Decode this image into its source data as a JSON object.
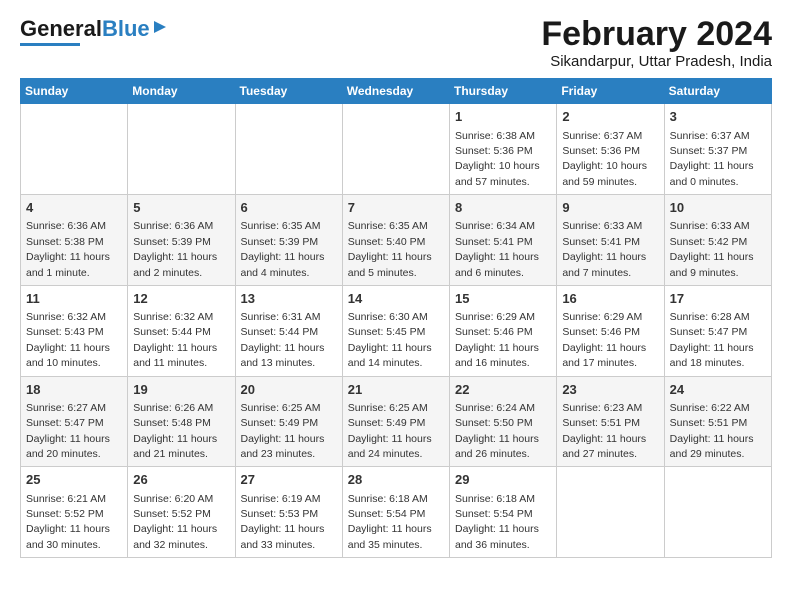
{
  "header": {
    "logo_general": "General",
    "logo_blue": "Blue",
    "title": "February 2024",
    "subtitle": "Sikandarpur, Uttar Pradesh, India"
  },
  "days_of_week": [
    "Sunday",
    "Monday",
    "Tuesday",
    "Wednesday",
    "Thursday",
    "Friday",
    "Saturday"
  ],
  "weeks": [
    [
      {
        "day": "",
        "info": ""
      },
      {
        "day": "",
        "info": ""
      },
      {
        "day": "",
        "info": ""
      },
      {
        "day": "",
        "info": ""
      },
      {
        "day": "1",
        "info": "Sunrise: 6:38 AM\nSunset: 5:36 PM\nDaylight: 10 hours and 57 minutes."
      },
      {
        "day": "2",
        "info": "Sunrise: 6:37 AM\nSunset: 5:36 PM\nDaylight: 10 hours and 59 minutes."
      },
      {
        "day": "3",
        "info": "Sunrise: 6:37 AM\nSunset: 5:37 PM\nDaylight: 11 hours and 0 minutes."
      }
    ],
    [
      {
        "day": "4",
        "info": "Sunrise: 6:36 AM\nSunset: 5:38 PM\nDaylight: 11 hours and 1 minute."
      },
      {
        "day": "5",
        "info": "Sunrise: 6:36 AM\nSunset: 5:39 PM\nDaylight: 11 hours and 2 minutes."
      },
      {
        "day": "6",
        "info": "Sunrise: 6:35 AM\nSunset: 5:39 PM\nDaylight: 11 hours and 4 minutes."
      },
      {
        "day": "7",
        "info": "Sunrise: 6:35 AM\nSunset: 5:40 PM\nDaylight: 11 hours and 5 minutes."
      },
      {
        "day": "8",
        "info": "Sunrise: 6:34 AM\nSunset: 5:41 PM\nDaylight: 11 hours and 6 minutes."
      },
      {
        "day": "9",
        "info": "Sunrise: 6:33 AM\nSunset: 5:41 PM\nDaylight: 11 hours and 7 minutes."
      },
      {
        "day": "10",
        "info": "Sunrise: 6:33 AM\nSunset: 5:42 PM\nDaylight: 11 hours and 9 minutes."
      }
    ],
    [
      {
        "day": "11",
        "info": "Sunrise: 6:32 AM\nSunset: 5:43 PM\nDaylight: 11 hours and 10 minutes."
      },
      {
        "day": "12",
        "info": "Sunrise: 6:32 AM\nSunset: 5:44 PM\nDaylight: 11 hours and 11 minutes."
      },
      {
        "day": "13",
        "info": "Sunrise: 6:31 AM\nSunset: 5:44 PM\nDaylight: 11 hours and 13 minutes."
      },
      {
        "day": "14",
        "info": "Sunrise: 6:30 AM\nSunset: 5:45 PM\nDaylight: 11 hours and 14 minutes."
      },
      {
        "day": "15",
        "info": "Sunrise: 6:29 AM\nSunset: 5:46 PM\nDaylight: 11 hours and 16 minutes."
      },
      {
        "day": "16",
        "info": "Sunrise: 6:29 AM\nSunset: 5:46 PM\nDaylight: 11 hours and 17 minutes."
      },
      {
        "day": "17",
        "info": "Sunrise: 6:28 AM\nSunset: 5:47 PM\nDaylight: 11 hours and 18 minutes."
      }
    ],
    [
      {
        "day": "18",
        "info": "Sunrise: 6:27 AM\nSunset: 5:47 PM\nDaylight: 11 hours and 20 minutes."
      },
      {
        "day": "19",
        "info": "Sunrise: 6:26 AM\nSunset: 5:48 PM\nDaylight: 11 hours and 21 minutes."
      },
      {
        "day": "20",
        "info": "Sunrise: 6:25 AM\nSunset: 5:49 PM\nDaylight: 11 hours and 23 minutes."
      },
      {
        "day": "21",
        "info": "Sunrise: 6:25 AM\nSunset: 5:49 PM\nDaylight: 11 hours and 24 minutes."
      },
      {
        "day": "22",
        "info": "Sunrise: 6:24 AM\nSunset: 5:50 PM\nDaylight: 11 hours and 26 minutes."
      },
      {
        "day": "23",
        "info": "Sunrise: 6:23 AM\nSunset: 5:51 PM\nDaylight: 11 hours and 27 minutes."
      },
      {
        "day": "24",
        "info": "Sunrise: 6:22 AM\nSunset: 5:51 PM\nDaylight: 11 hours and 29 minutes."
      }
    ],
    [
      {
        "day": "25",
        "info": "Sunrise: 6:21 AM\nSunset: 5:52 PM\nDaylight: 11 hours and 30 minutes."
      },
      {
        "day": "26",
        "info": "Sunrise: 6:20 AM\nSunset: 5:52 PM\nDaylight: 11 hours and 32 minutes."
      },
      {
        "day": "27",
        "info": "Sunrise: 6:19 AM\nSunset: 5:53 PM\nDaylight: 11 hours and 33 minutes."
      },
      {
        "day": "28",
        "info": "Sunrise: 6:18 AM\nSunset: 5:54 PM\nDaylight: 11 hours and 35 minutes."
      },
      {
        "day": "29",
        "info": "Sunrise: 6:18 AM\nSunset: 5:54 PM\nDaylight: 11 hours and 36 minutes."
      },
      {
        "day": "",
        "info": ""
      },
      {
        "day": "",
        "info": ""
      }
    ]
  ]
}
